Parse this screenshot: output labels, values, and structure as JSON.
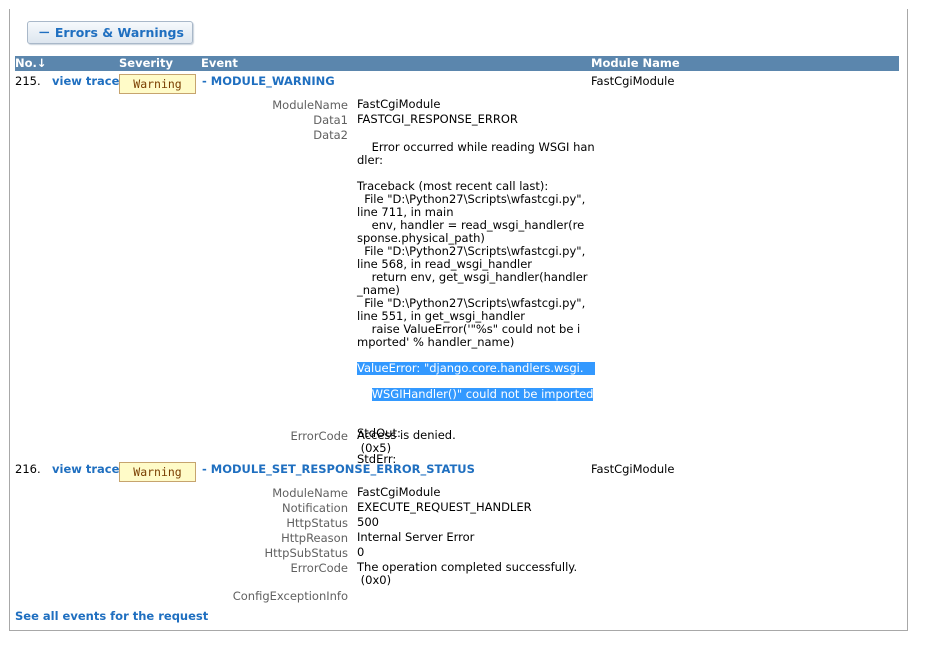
{
  "section_toggle": "－ Errors & Warnings",
  "columns": {
    "no": "No.↓",
    "severity": "Severity",
    "event": "Event",
    "module": "Module Name"
  },
  "events": [
    {
      "no": "215.",
      "view_trace": "view trace",
      "severity": "Warning",
      "event": "- MODULE_WARNING",
      "module": "FastCgiModule",
      "details": {
        "module_name_label": "ModuleName",
        "module_name": "FastCgiModule",
        "data1_label": "Data1",
        "data1": "FASTCGI_RESPONSE_ERROR",
        "data2_label": "Data2",
        "data2_text": "Error occurred while reading WSGI han\ndler:\n\nTraceback (most recent call last):\n  File \"D:\\Python27\\Scripts\\wfastcgi.py\",\nline 711, in main\n    env, handler = read_wsgi_handler(re\nsponse.physical_path)\n  File \"D:\\Python27\\Scripts\\wfastcgi.py\",\nline 568, in read_wsgi_handler\n    return env, get_wsgi_handler(handler\n_name)\n  File \"D:\\Python27\\Scripts\\wfastcgi.py\",\nline 551, in get_wsgi_handler\n    raise ValueError('\"%s\" could not be i\nmported' % handler_name)",
        "data2_selected_1": "ValueError: \"django.core.handlers.wsgi.",
        "data2_selected_2": "WSGIHandler()\" could not be imported",
        "data2_tail": "\n\nStdOut:\n\nStdErr:",
        "error_code_label": "ErrorCode",
        "error_code": "Access is denied.\n (0x5)"
      }
    },
    {
      "no": "216.",
      "view_trace": "view trace",
      "severity": "Warning",
      "event": "- MODULE_SET_RESPONSE_ERROR_STATUS",
      "module": "FastCgiModule",
      "details": {
        "module_name_label": "ModuleName",
        "module_name": "FastCgiModule",
        "notification_label": "Notification",
        "notification": "EXECUTE_REQUEST_HANDLER",
        "http_status_label": "HttpStatus",
        "http_status": "500",
        "http_reason_label": "HttpReason",
        "http_reason": "Internal Server Error",
        "http_substatus_label": "HttpSubStatus",
        "http_substatus": "0",
        "error_code_label": "ErrorCode",
        "error_code": "The operation completed successfully.\n (0x0)",
        "config_exception_label": "ConfigExceptionInfo"
      }
    }
  ],
  "footer_link": "See all events for the request",
  "colors": {
    "header": "#5b86ad",
    "link": "#1f6fc0",
    "badge_bg": "#fffbc8",
    "selection": "#3399ff"
  }
}
